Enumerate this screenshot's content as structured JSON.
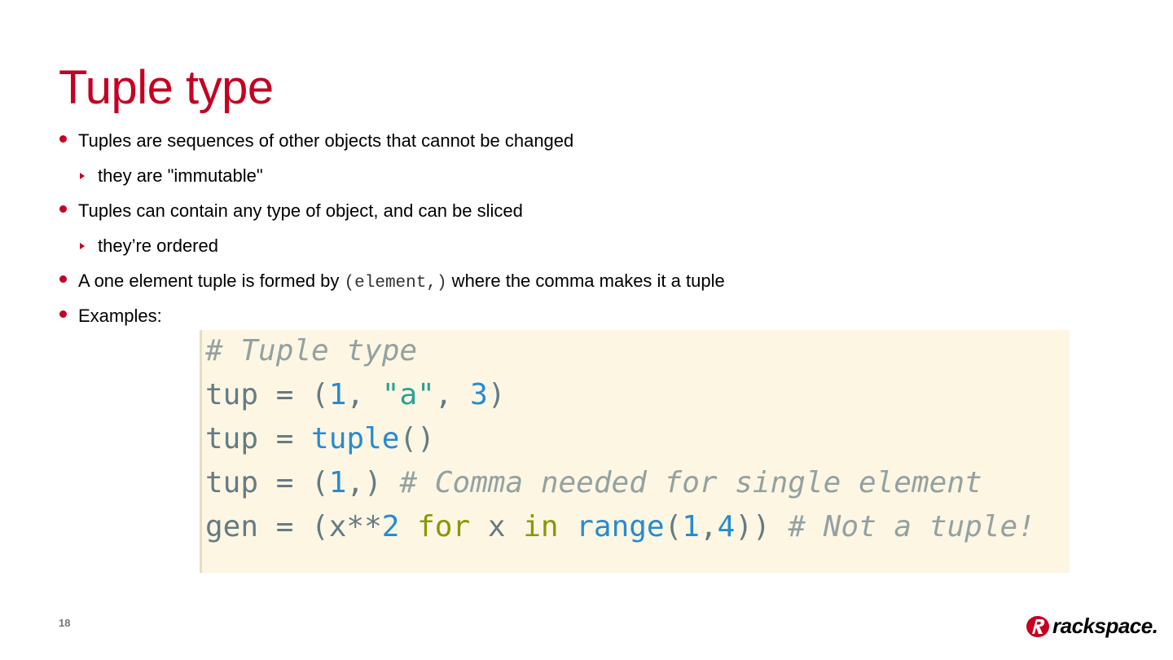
{
  "slide": {
    "title": "Tuple type",
    "page_number": "18"
  },
  "bullets": [
    {
      "level": 1,
      "text": "Tuples are sequences of other objects that cannot be changed"
    },
    {
      "level": 2,
      "text": "they are \"immutable\""
    },
    {
      "level": 1,
      "text": "Tuples can contain any type of object, and can be sliced"
    },
    {
      "level": 2,
      "text": "they’re ordered"
    },
    {
      "level": 1,
      "text_before": "A one element tuple is formed by ",
      "code": "(element,)",
      "text_after": " where the comma makes it a tuple"
    },
    {
      "level": 1,
      "text": "Examples:"
    }
  ],
  "code_example": {
    "lines": [
      [
        {
          "t": "# Tuple type",
          "k": "comment"
        }
      ],
      [
        {
          "t": "tup = (",
          "k": "plain"
        },
        {
          "t": "1",
          "k": "num"
        },
        {
          "t": ", ",
          "k": "plain"
        },
        {
          "t": "\"a\"",
          "k": "str"
        },
        {
          "t": ", ",
          "k": "plain"
        },
        {
          "t": "3",
          "k": "num"
        },
        {
          "t": ")",
          "k": "plain"
        }
      ],
      [
        {
          "t": "tup = ",
          "k": "plain"
        },
        {
          "t": "tuple",
          "k": "builtin"
        },
        {
          "t": "()",
          "k": "plain"
        }
      ],
      [
        {
          "t": "tup = (",
          "k": "plain"
        },
        {
          "t": "1",
          "k": "num"
        },
        {
          "t": ",) ",
          "k": "plain"
        },
        {
          "t": "# Comma needed for single element",
          "k": "comment"
        }
      ],
      [
        {
          "t": "gen = (x**",
          "k": "plain"
        },
        {
          "t": "2",
          "k": "num"
        },
        {
          "t": " ",
          "k": "plain"
        },
        {
          "t": "for",
          "k": "kw"
        },
        {
          "t": " x ",
          "k": "plain"
        },
        {
          "t": "in",
          "k": "kw"
        },
        {
          "t": " ",
          "k": "plain"
        },
        {
          "t": "range",
          "k": "builtin"
        },
        {
          "t": "(",
          "k": "plain"
        },
        {
          "t": "1",
          "k": "num"
        },
        {
          "t": ",",
          "k": "plain"
        },
        {
          "t": "4",
          "k": "num"
        },
        {
          "t": ")) ",
          "k": "plain"
        },
        {
          "t": "# Not a tuple!",
          "k": "comment"
        }
      ]
    ]
  },
  "logo": {
    "text": "rackspace.",
    "brand_color": "#c40022"
  },
  "colors": {
    "accent": "#c40022",
    "code_background": "#fdf6e3"
  }
}
